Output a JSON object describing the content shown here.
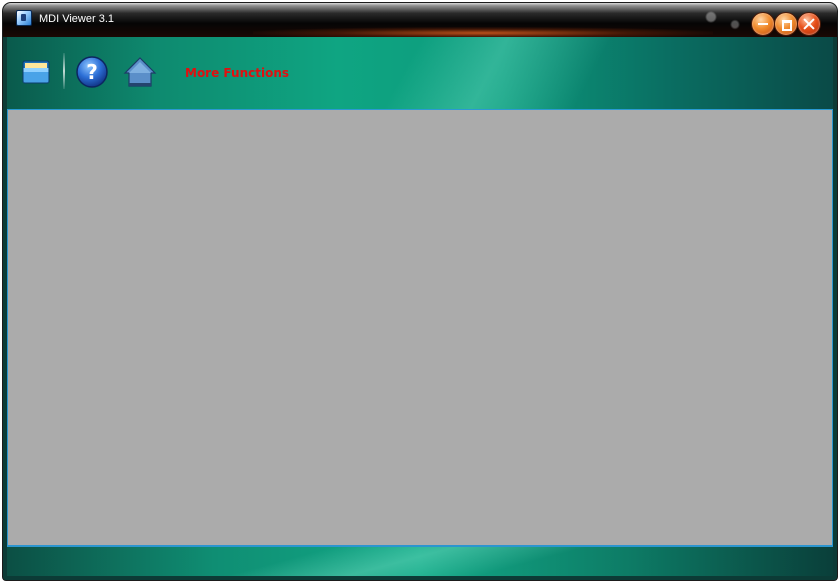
{
  "window": {
    "title": "MDI Viewer 3.1"
  },
  "title_controls": {
    "minimize_icon": "minimize-icon",
    "maximize_icon": "maximize-icon",
    "close_icon": "close-icon"
  },
  "toolbar": {
    "buttons": [
      {
        "icon": "folder-open-icon"
      },
      {
        "icon": "help-icon"
      },
      {
        "icon": "home-icon"
      }
    ],
    "more_functions_label": "More Functions"
  },
  "colors": {
    "accent_link": "#e01010",
    "toolbar_teal": "#0fa582",
    "client_gray": "#ababab",
    "border_blue": "#2b95cf"
  }
}
